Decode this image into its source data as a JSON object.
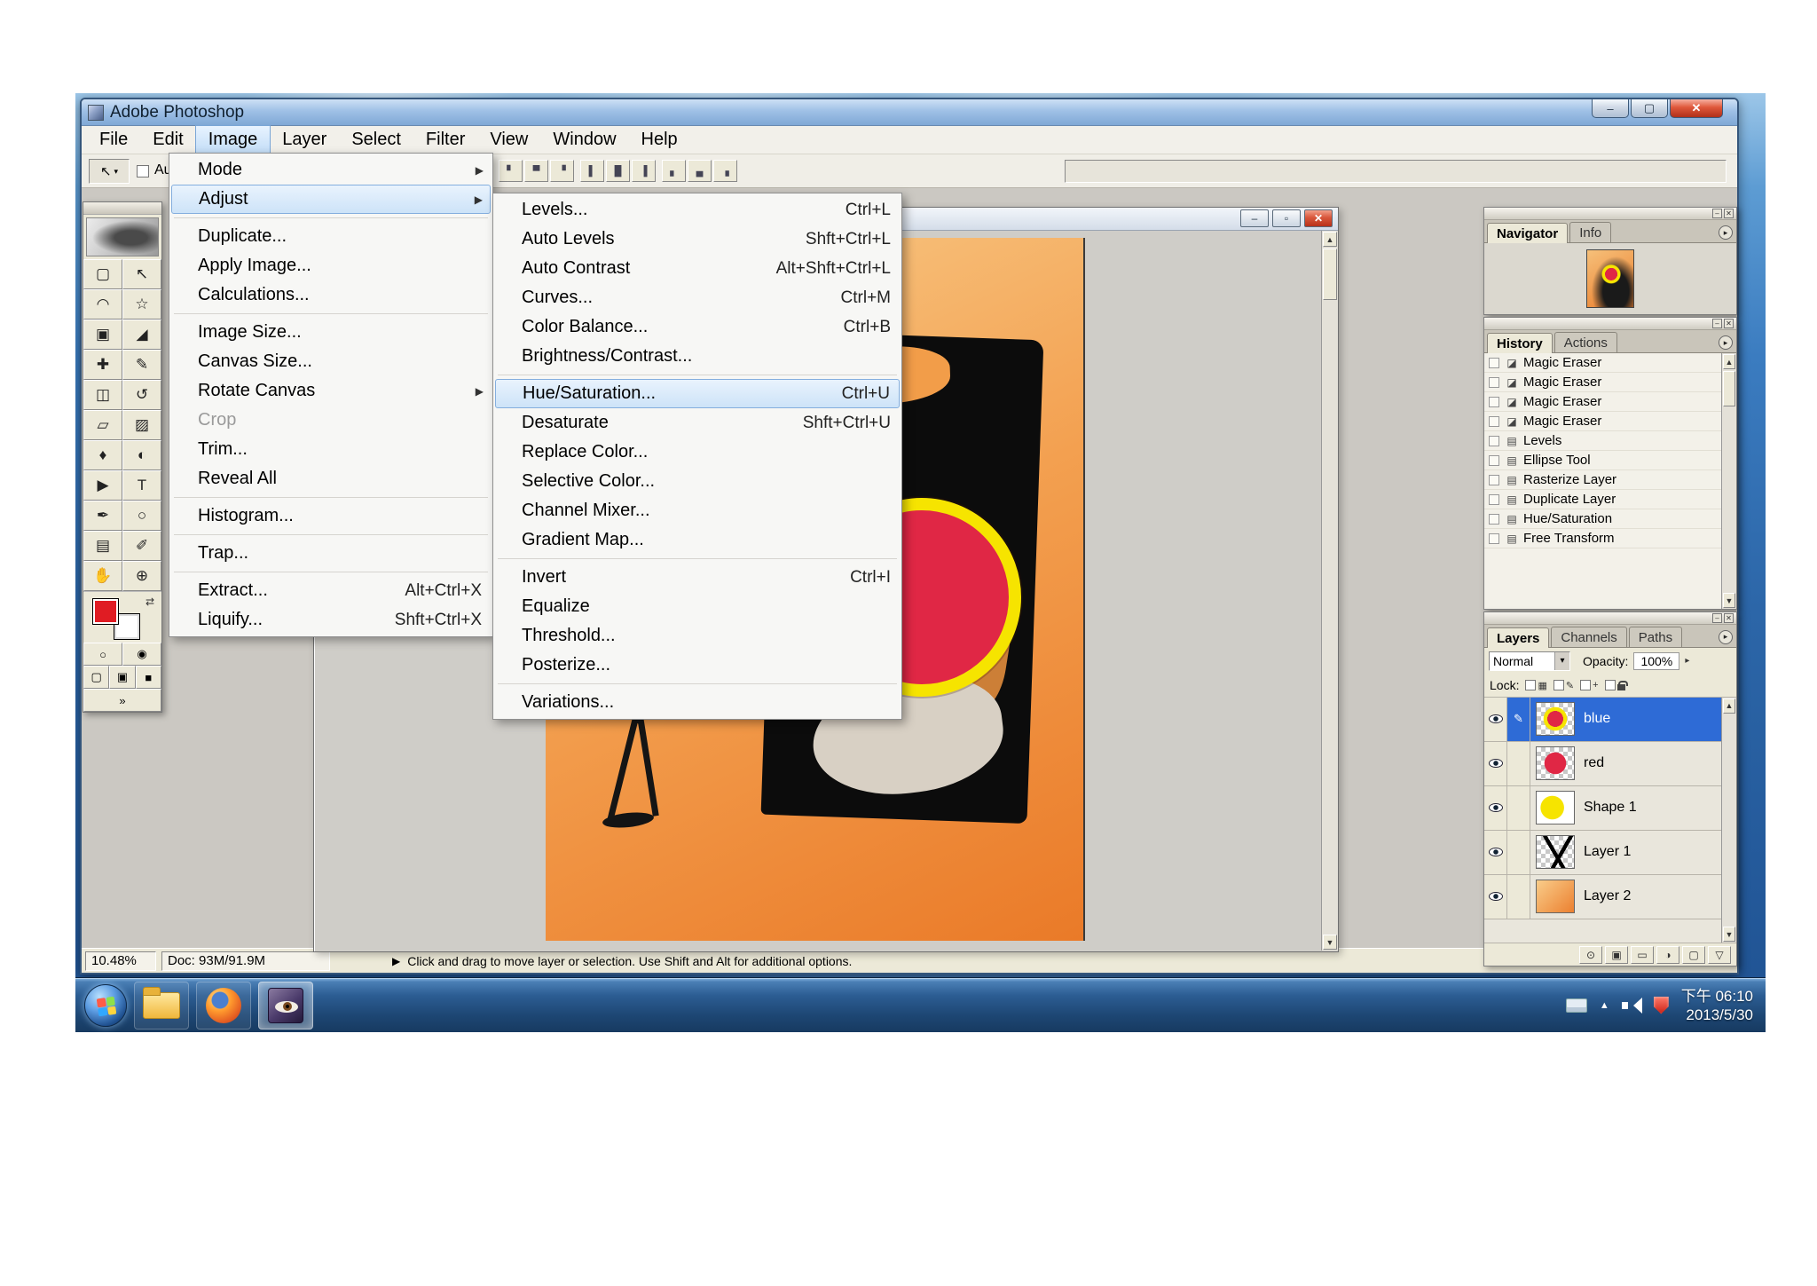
{
  "colors": {
    "selection_blue": "#2e6bd6",
    "menu_highlight": "#cde3f8",
    "titlebar_blue": "#9fc0e6",
    "canvas_orange": "#f3a050",
    "circle_red": "#e02745",
    "circle_ring_yellow": "#f6e400",
    "taskbar_blue": "#1d4673",
    "foreground_swatch_red": "#e01c23"
  },
  "icons": {
    "minimize": "‒",
    "maximize": "▢",
    "close": "✕",
    "doc_minimize": "‒",
    "doc_restore": "▫",
    "submenu_arrow": "▶",
    "dropdown_arrow": "▾",
    "scroll_up": "▲",
    "scroll_down": "▼",
    "panel_menu": "▸",
    "brush": "✎",
    "swap_arrows": "⇄",
    "hint_arrow": "▶",
    "tray_up": "▲"
  },
  "window": {
    "title": "Adobe Photoshop"
  },
  "menu_bar": {
    "items": [
      "File",
      "Edit",
      "Image",
      "Layer",
      "Select",
      "Filter",
      "View",
      "Window",
      "Help"
    ]
  },
  "options_bar": {
    "tool_glyph": "↖",
    "auto_label": "Aut",
    "align_glyphs": [
      "▘",
      "▀",
      "▝",
      "▌",
      "█",
      "▐",
      "▖",
      "▄",
      "▗"
    ]
  },
  "image_menu": {
    "items": [
      {
        "label": "Mode",
        "shortcut": ""
      },
      {
        "label": "Adjust",
        "shortcut": ""
      },
      {
        "label": "Duplicate...",
        "shortcut": ""
      },
      {
        "label": "Apply Image...",
        "shortcut": ""
      },
      {
        "label": "Calculations...",
        "shortcut": ""
      },
      {
        "label": "Image Size...",
        "shortcut": ""
      },
      {
        "label": "Canvas Size...",
        "shortcut": ""
      },
      {
        "label": "Rotate Canvas",
        "shortcut": ""
      },
      {
        "label": "Crop",
        "shortcut": ""
      },
      {
        "label": "Trim...",
        "shortcut": ""
      },
      {
        "label": "Reveal All",
        "shortcut": ""
      },
      {
        "label": "Histogram...",
        "shortcut": ""
      },
      {
        "label": "Trap...",
        "shortcut": ""
      },
      {
        "label": "Extract...",
        "shortcut": "Alt+Ctrl+X"
      },
      {
        "label": "Liquify...",
        "shortcut": "Shft+Ctrl+X"
      }
    ]
  },
  "adjust_submenu": {
    "items": [
      {
        "label": "Levels...",
        "shortcut": "Ctrl+L"
      },
      {
        "label": "Auto Levels",
        "shortcut": "Shft+Ctrl+L"
      },
      {
        "label": "Auto Contrast",
        "shortcut": "Alt+Shft+Ctrl+L"
      },
      {
        "label": "Curves...",
        "shortcut": "Ctrl+M"
      },
      {
        "label": "Color Balance...",
        "shortcut": "Ctrl+B"
      },
      {
        "label": "Brightness/Contrast...",
        "shortcut": ""
      },
      {
        "label": "Hue/Saturation...",
        "shortcut": "Ctrl+U"
      },
      {
        "label": "Desaturate",
        "shortcut": "Shft+Ctrl+U"
      },
      {
        "label": "Replace Color...",
        "shortcut": ""
      },
      {
        "label": "Selective Color...",
        "shortcut": ""
      },
      {
        "label": "Channel Mixer...",
        "shortcut": ""
      },
      {
        "label": "Gradient Map...",
        "shortcut": ""
      },
      {
        "label": "Invert",
        "shortcut": "Ctrl+I"
      },
      {
        "label": "Equalize",
        "shortcut": ""
      },
      {
        "label": "Threshold...",
        "shortcut": ""
      },
      {
        "label": "Posterize...",
        "shortcut": ""
      },
      {
        "label": "Variations...",
        "shortcut": ""
      }
    ]
  },
  "toolbox": {
    "tools": [
      {
        "name": "rect-marquee",
        "glyph": "▢"
      },
      {
        "name": "move",
        "glyph": "↖"
      },
      {
        "name": "lasso",
        "glyph": "◠"
      },
      {
        "name": "magic-wand",
        "glyph": "☆"
      },
      {
        "name": "crop",
        "glyph": "▣"
      },
      {
        "name": "slice",
        "glyph": "◢"
      },
      {
        "name": "healing-brush",
        "glyph": "✚"
      },
      {
        "name": "brush",
        "glyph": "✎"
      },
      {
        "name": "clone-stamp",
        "glyph": "◫"
      },
      {
        "name": "history-brush",
        "glyph": "↺"
      },
      {
        "name": "eraser",
        "glyph": "▱"
      },
      {
        "name": "gradient",
        "glyph": "▨"
      },
      {
        "name": "blur",
        "glyph": "♦"
      },
      {
        "name": "dodge",
        "glyph": "◐"
      },
      {
        "name": "path-select",
        "glyph": "▶"
      },
      {
        "name": "type",
        "glyph": "T"
      },
      {
        "name": "pen",
        "glyph": "✒"
      },
      {
        "name": "shape",
        "glyph": "○"
      },
      {
        "name": "notes",
        "glyph": "▤"
      },
      {
        "name": "eyedropper",
        "glyph": "✐"
      },
      {
        "name": "hand",
        "glyph": "✋"
      },
      {
        "name": "zoom",
        "glyph": "⊕"
      }
    ],
    "extras": {
      "qm_normal": "○",
      "qm_quick": "◉",
      "screen_std": "▢",
      "screen_menu": "▣",
      "screen_full": "■",
      "imageready": "»"
    }
  },
  "navigator_panel": {
    "tabs": [
      "Navigator",
      "Info"
    ]
  },
  "history_panel": {
    "tabs": [
      "History",
      "Actions"
    ],
    "items": [
      {
        "icon": "◪",
        "label": "Magic Eraser"
      },
      {
        "icon": "◪",
        "label": "Magic Eraser"
      },
      {
        "icon": "◪",
        "label": "Magic Eraser"
      },
      {
        "icon": "◪",
        "label": "Magic Eraser"
      },
      {
        "icon": "▤",
        "label": "Levels"
      },
      {
        "icon": "▤",
        "label": "Ellipse Tool"
      },
      {
        "icon": "▤",
        "label": "Rasterize Layer"
      },
      {
        "icon": "▤",
        "label": "Duplicate Layer"
      },
      {
        "icon": "▤",
        "label": "Hue/Saturation"
      },
      {
        "icon": "▤",
        "label": "Free Transform"
      }
    ]
  },
  "layers_panel": {
    "tabs": [
      "Layers",
      "Channels",
      "Paths"
    ],
    "blend_mode": "Normal",
    "opacity_label": "Opacity:",
    "opacity_value": "100%",
    "lock_label": "Lock:",
    "lock_glyphs": [
      "▦",
      "✎",
      "+"
    ],
    "layers": [
      {
        "name": "blue"
      },
      {
        "name": "red"
      },
      {
        "name": "Shape 1"
      },
      {
        "name": "Layer 1"
      },
      {
        "name": "Layer 2"
      }
    ]
  },
  "status_bar": {
    "zoom": "10.48%",
    "doc": "Doc: 93M/91.9M",
    "hint": "Click and drag to move layer or selection. Use Shift and Alt for additional options."
  },
  "taskbar": {
    "time": "下午 06:10",
    "date": "2013/5/30"
  }
}
